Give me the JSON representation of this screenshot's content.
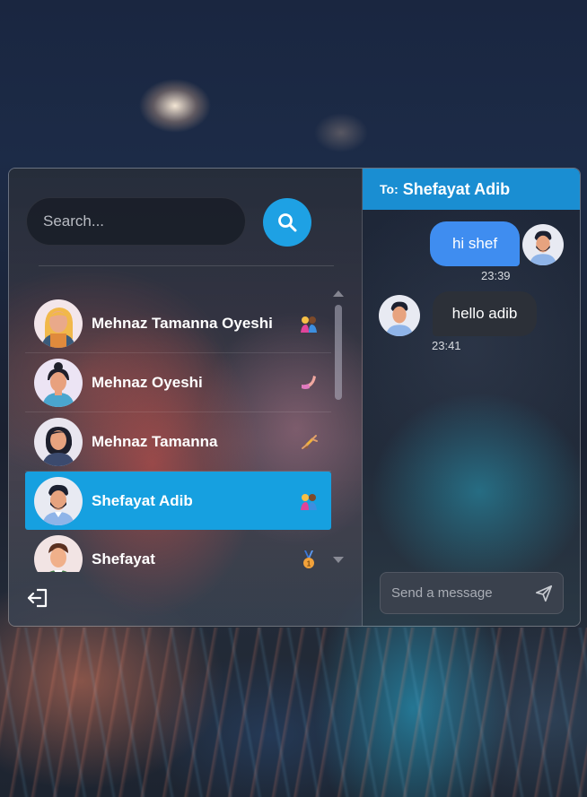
{
  "search": {
    "placeholder": "Search..."
  },
  "contacts": [
    {
      "name": "Mehnaz Tamanna Oyeshi",
      "avatar": "woman-blonde-avatar",
      "emoji": "hugging-kids-emoji",
      "active": false
    },
    {
      "name": "Mehnaz Oyeshi",
      "avatar": "woman-bun-avatar",
      "emoji": "flexed-arm-emoji",
      "active": false
    },
    {
      "name": "Mehnaz Tamanna",
      "avatar": "woman-dark-hair-avatar",
      "emoji": "acrobat-emoji",
      "active": false
    },
    {
      "name": "Shefayat Adib",
      "avatar": "man-beard-avatar",
      "emoji": "hugging-kids-emoji",
      "active": true
    },
    {
      "name": "Shefayat",
      "avatar": "man-green-shirt-avatar",
      "emoji": "medal-emoji",
      "active": false
    }
  ],
  "chat": {
    "to_label": "To:",
    "recipient": "Shefayat Adib",
    "messages": [
      {
        "text": "hi shef",
        "time": "23:39",
        "direction": "outgoing"
      },
      {
        "text": "hello adib",
        "time": "23:41",
        "direction": "incoming"
      }
    ],
    "input_placeholder": "Send a message"
  },
  "colors": {
    "accent": "#1ea1e4",
    "active_row": "#16a0e0",
    "header": "#1a8ed2",
    "outgoing_bubble": "#3f8df0",
    "incoming_bubble": "#2c3038"
  },
  "icons": {
    "search": "search-icon",
    "logout": "logout-icon",
    "send": "send-icon"
  }
}
